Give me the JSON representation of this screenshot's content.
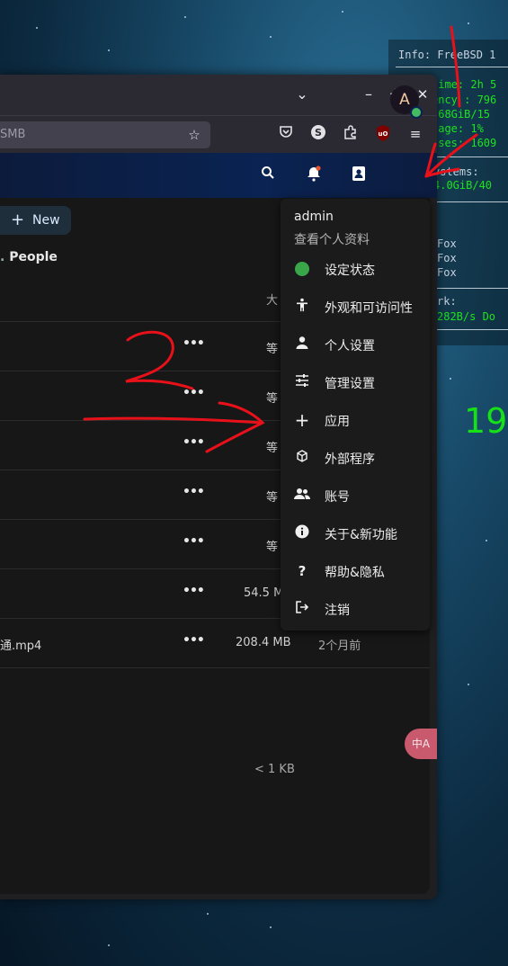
{
  "conky": {
    "info": "Info: FreeBSD 1",
    "uptime": "time: 2h 5",
    "freq": "ency : 796",
    "ram": ".68GiB/15",
    "usage": "sage: 1% ",
    "procs": "sses: 1609",
    "fs_label": "ystems:",
    "fs_value": "4.0GiB/40",
    "proc1": "Fox",
    "proc2": "Fox",
    "proc3": "Fox",
    "net_label": "rk:",
    "net_value": "282B/s  Do",
    "clock": "19:"
  },
  "toolbar": {
    "url_fragment": "SMB"
  },
  "header": {
    "avatar_letter": "A"
  },
  "files": {
    "new_label": "New",
    "people_label": "People",
    "col_size": "大",
    "rows": [
      {
        "name": "",
        "size": "等"
      },
      {
        "name": "",
        "size": "等"
      },
      {
        "name": "",
        "size": "等"
      },
      {
        "name": "",
        "size": "等"
      },
      {
        "name": "",
        "size": "等"
      },
      {
        "name": "",
        "size": "54.5 M"
      },
      {
        "name": "通.mp4",
        "size": "208.4 MB",
        "modified": "2个月前"
      }
    ],
    "total": "< 1 KB"
  },
  "menu": {
    "username": "admin",
    "view_profile": "查看个人资料",
    "items": [
      {
        "label": "设定状态",
        "icon": "status-dot-icon"
      },
      {
        "label": "外观和可访问性",
        "icon": "accessibility-icon"
      },
      {
        "label": "个人设置",
        "icon": "person-icon"
      },
      {
        "label": "管理设置",
        "icon": "sliders-icon"
      },
      {
        "label": "应用",
        "icon": "plus-icon"
      },
      {
        "label": "外部程序",
        "icon": "cube-icon"
      },
      {
        "label": "账号",
        "icon": "users-icon"
      },
      {
        "label": "关于&新功能",
        "icon": "info-icon"
      },
      {
        "label": "帮助&隐私",
        "icon": "question-icon"
      },
      {
        "label": "注销",
        "icon": "logout-icon"
      }
    ]
  },
  "translate_label": "中A",
  "colors": {
    "accent_green": "#3aa64a",
    "conky_green": "#1ee31e",
    "header_blue": "#0a2352",
    "annotation_red": "#e8111a"
  }
}
